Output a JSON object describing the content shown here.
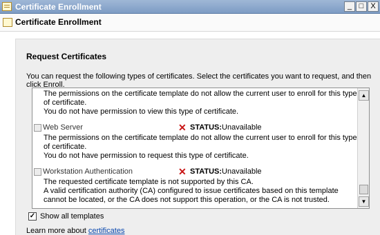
{
  "window": {
    "title": "Certificate Enrollment",
    "minimize_glyph": "_",
    "maximize_glyph": "□",
    "close_glyph": "X"
  },
  "header": {
    "title": "Certificate Enrollment",
    "icon": "certificate-icon"
  },
  "section": {
    "title": "Request Certificates",
    "description": "You can request the following types of certificates. Select the certificates you want to request, and then click Enroll."
  },
  "list": {
    "partial_top": {
      "line1": "The permissions on the certificate template do not allow the current user to enroll for this type of certificate.",
      "line2": "You do not have permission to view this type of certificate."
    },
    "items": [
      {
        "name": "Web Server",
        "status_label": "STATUS:",
        "status_value": "Unavailable",
        "line1": "The permissions on the certificate template do not allow the current user to enroll for this type of certificate.",
        "line2": "You do not have permission to request this type of certificate."
      },
      {
        "name": "Workstation Authentication",
        "status_label": "STATUS:",
        "status_value": "Unavailable",
        "line1": "The requested certificate template is not supported by this CA.",
        "line2": "A valid certification authority (CA) configured to issue certificates based on this template cannot be located, or the CA does not support this operation, or the CA is not trusted."
      }
    ],
    "status_icon": "x-icon",
    "status_color": "#c81414"
  },
  "show_all": {
    "label": "Show all templates",
    "checked": true,
    "check_glyph": "✓"
  },
  "learn": {
    "prefix": "Learn more about ",
    "link": "certificates"
  }
}
